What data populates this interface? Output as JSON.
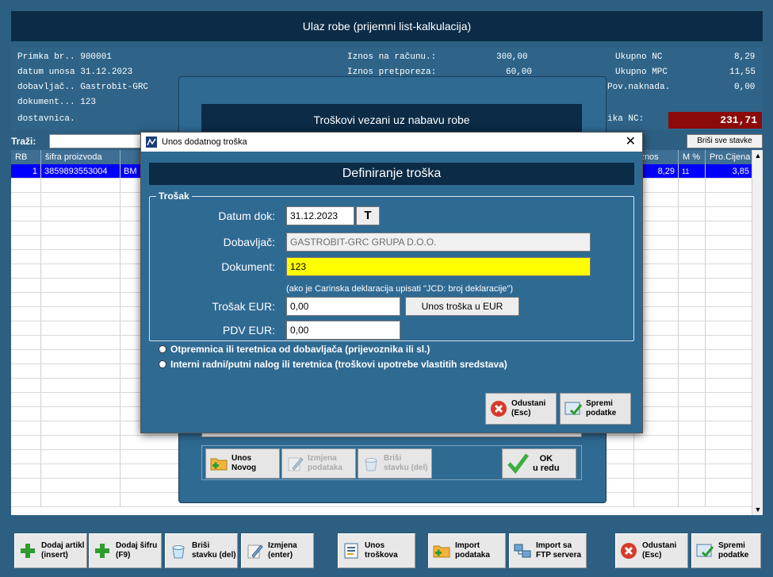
{
  "main_title": "Ulaz robe (prijemni list-kalkulacija)",
  "info": {
    "primka": "Primka br.. 900001",
    "datum": "datum unosa 31.12.2023",
    "dobavljac": "dobavljač.. Gastrobit-GRC",
    "dokument": "dokument... 123",
    "dostavnica": "dostavnica.",
    "iznos_label": "Iznos na računu.:",
    "iznos_value": "300,00",
    "pretporez_label": "Iznos pretporeza:",
    "pretporez_value": "60,00",
    "nc_label": "Ukupno NC",
    "nc_value": "8,29",
    "mpc_label": "Ukupno MPC",
    "mpc_value": "11,55",
    "povn_label": "Pov.naknada.",
    "povn_value": "0,00",
    "ukupno_label": "ika NC:",
    "ukupno_value": "231,71"
  },
  "search": {
    "label": "Traži:"
  },
  "obrisi_label": "Briši sve stavke",
  "grid": {
    "headers": {
      "rb": "RB",
      "sifra": "šifra proizvoda",
      "iznos": "iznos",
      "m": "M %",
      "pro": "Pro.Cijena"
    },
    "row": {
      "rb": "1",
      "sifra": "3859893553004",
      "naziv": "BM",
      "iznos": "8,29",
      "m": "11",
      "pro": "3,85"
    }
  },
  "bottom": {
    "dodaj_artikl": "Dodaj artikl\n(insert)",
    "dodaj_sifru": "Dodaj šifru\n(F9)",
    "brisi": "Briši\nstavku (del)",
    "izmjena": "Izmjena\n(enter)",
    "unos_troskova": "Unos\ntroškova",
    "import": "Import\npodataka",
    "import_ftp": "Import sa\nFTP servera",
    "odustani": "Odustani\n(Esc)",
    "spremi": "Spremi\npodatke"
  },
  "troskovi": {
    "title": "Troškovi vezani uz nabavu robe",
    "unos_novog": "Unos\nNovog",
    "izmjena": "Izmjena\npodataka",
    "brisi": "Briši\nstavku (del)",
    "ok": "OK\nu redu"
  },
  "modal": {
    "window_title": "Unos dodatnog troška",
    "close": "✕",
    "heading": "Definiranje troška",
    "legend": "Trošak",
    "datum_label": "Datum dok:",
    "datum_value": "31.12.2023",
    "t_button": "T",
    "dobavljac_label": "Dobavljač:",
    "dobavljac_value": "GASTROBIT-GRC GRUPA D.O.O.",
    "dokument_label": "Dokument:",
    "dokument_value": "123",
    "hint": "(ako je Carinska deklaracija upisati \"JCD: broj deklaracije\")",
    "trosak_label": "Trošak EUR:",
    "trosak_value": "0,00",
    "unos_eur": "Unos troška u EUR",
    "pdv_label": "PDV EUR:",
    "pdv_value": "0,00",
    "radio1": "Otpremnica ili teretnica od dobavljača (prijevoznika ili sl.)",
    "radio2": "Interni radni/putni nalog ili teretnica (troškovi upotrebe vlastitih sredstava)",
    "odustani": "Odustani\n(Esc)",
    "spremi": "Spremi\npodatke"
  },
  "colors": {
    "navy": "#0b2b46",
    "panel": "#2f6a93",
    "selected": "#0000ff",
    "total_bg": "#8b0a0a",
    "highlight": "#ffff00"
  }
}
